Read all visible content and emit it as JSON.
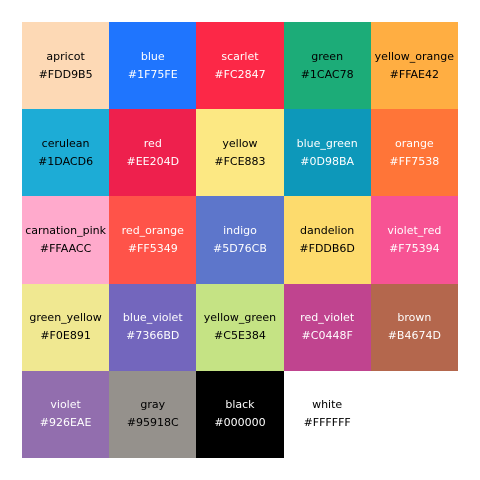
{
  "swatches": [
    {
      "name": "apricot",
      "hex": "#FDD9B5",
      "text_color": "#000000"
    },
    {
      "name": "blue",
      "hex": "#1F75FE",
      "text_color": "#FFFFFF"
    },
    {
      "name": "scarlet",
      "hex": "#FC2847",
      "text_color": "#FFFFFF"
    },
    {
      "name": "green",
      "hex": "#1CAC78",
      "text_color": "#000000"
    },
    {
      "name": "yellow_orange",
      "hex": "#FFAE42",
      "text_color": "#000000"
    },
    {
      "name": "cerulean",
      "hex": "#1DACD6",
      "text_color": "#000000"
    },
    {
      "name": "red",
      "hex": "#EE204D",
      "text_color": "#FFFFFF"
    },
    {
      "name": "yellow",
      "hex": "#FCE883",
      "text_color": "#000000"
    },
    {
      "name": "blue_green",
      "hex": "#0D98BA",
      "text_color": "#FFFFFF"
    },
    {
      "name": "orange",
      "hex": "#FF7538",
      "text_color": "#FFFFFF"
    },
    {
      "name": "carnation_pink",
      "hex": "#FFAACC",
      "text_color": "#000000"
    },
    {
      "name": "red_orange",
      "hex": "#FF5349",
      "text_color": "#FFFFFF"
    },
    {
      "name": "indigo",
      "hex": "#5D76CB",
      "text_color": "#FFFFFF"
    },
    {
      "name": "dandelion",
      "hex": "#FDDB6D",
      "text_color": "#000000"
    },
    {
      "name": "violet_red",
      "hex": "#F75394",
      "text_color": "#FFFFFF"
    },
    {
      "name": "green_yellow",
      "hex": "#F0E891",
      "text_color": "#000000"
    },
    {
      "name": "blue_violet",
      "hex": "#7366BD",
      "text_color": "#FFFFFF"
    },
    {
      "name": "yellow_green",
      "hex": "#C5E384",
      "text_color": "#000000"
    },
    {
      "name": "red_violet",
      "hex": "#C0448F",
      "text_color": "#FFFFFF"
    },
    {
      "name": "brown",
      "hex": "#B4674D",
      "text_color": "#FFFFFF"
    },
    {
      "name": "violet",
      "hex": "#926EAE",
      "text_color": "#FFFFFF"
    },
    {
      "name": "gray",
      "hex": "#95918C",
      "text_color": "#000000"
    },
    {
      "name": "black",
      "hex": "#000000",
      "text_color": "#FFFFFF"
    },
    {
      "name": "white",
      "hex": "#FFFFFF",
      "text_color": "#000000"
    }
  ]
}
